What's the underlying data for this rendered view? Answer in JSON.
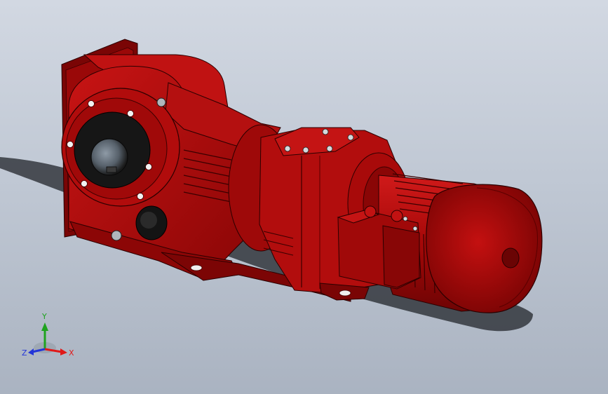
{
  "viewport": {
    "background_top": "#d2d8e2",
    "background_bottom": "#aab3c1",
    "model": {
      "object": "helical-bevel-gear-motor",
      "body_color": "#b30a0a",
      "highlight_color": "#d41e1e",
      "shadow_color": "#6a0404",
      "edge_color": "#2a0000",
      "bore_color": "#1c1c1c"
    }
  },
  "triad": {
    "x_label": "X",
    "y_label": "Y",
    "z_label": "Z",
    "x_color": "#e01919",
    "y_color": "#1fa31f",
    "z_color": "#2335d8"
  }
}
